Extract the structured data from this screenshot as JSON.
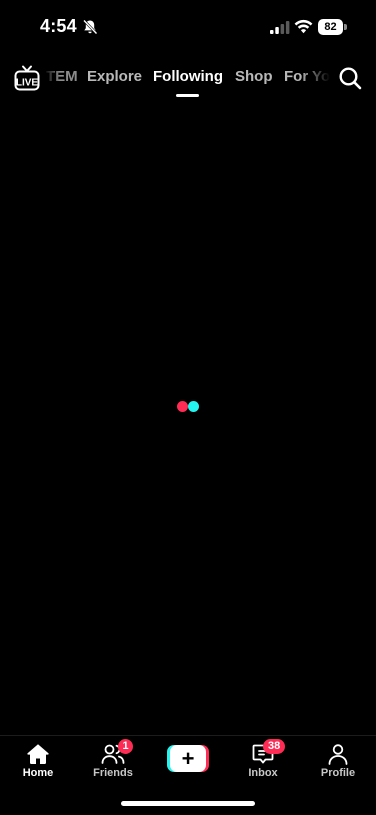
{
  "status_bar": {
    "time": "4:54",
    "battery": "82",
    "icons": [
      "bell-slash-icon",
      "signal-icon",
      "wifi-icon",
      "battery-icon"
    ]
  },
  "top_nav": {
    "live_label": "LIVE",
    "tabs": [
      {
        "label": "TEM",
        "active": false
      },
      {
        "label": "Explore",
        "active": false
      },
      {
        "label": "Following",
        "active": true
      },
      {
        "label": "Shop",
        "active": false
      },
      {
        "label": "For You",
        "active": false
      }
    ],
    "search_icon": "search-icon"
  },
  "loader": {
    "colors": [
      "#fe2c55",
      "#25f4ee"
    ]
  },
  "bottom_bar": {
    "tabs": [
      {
        "label": "Home",
        "icon": "home-icon",
        "active": true
      },
      {
        "label": "Friends",
        "icon": "friends-icon",
        "badge": "1"
      },
      {
        "label": "",
        "icon": "plus-icon"
      },
      {
        "label": "Inbox",
        "icon": "inbox-icon",
        "badge": "38"
      },
      {
        "label": "Profile",
        "icon": "profile-icon"
      }
    ]
  },
  "colors": {
    "background": "#000000",
    "accent_red": "#fe2c55",
    "accent_cyan": "#25f4ee"
  }
}
